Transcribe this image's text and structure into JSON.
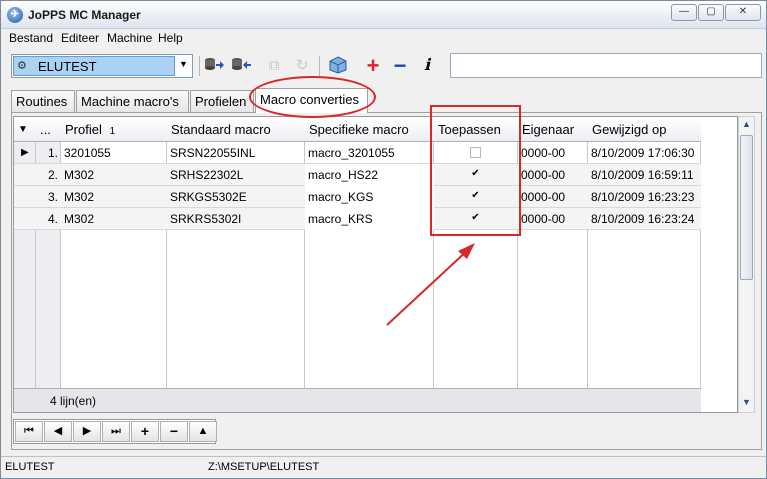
{
  "window": {
    "title": "JoPPS MC Manager",
    "controls": {
      "minimize": "—",
      "maximize": "▢",
      "close": "✕"
    }
  },
  "menu": [
    "Bestand",
    "Editeer",
    "Machine",
    "Help"
  ],
  "toolbar": {
    "machine_combo_value": "ELUTEST",
    "icons": [
      "db-export-icon",
      "db-import-icon",
      "copy-disabled-icon",
      "refresh-disabled-icon",
      "package-icon",
      "add-icon",
      "remove-icon",
      "info-icon"
    ]
  },
  "tabs": [
    {
      "label": "Routines",
      "active": false
    },
    {
      "label": "Machine macro's",
      "active": false
    },
    {
      "label": "Profielen",
      "active": false
    },
    {
      "label": "Macro converties",
      "active": true
    }
  ],
  "grid": {
    "columns": [
      "",
      "...",
      "Profiel",
      "Standaard macro",
      "Specifieke macro",
      "Toepassen",
      "Eigenaar",
      "Gewijzigd op"
    ],
    "sort_badge": "1",
    "rows": [
      {
        "num": "1.",
        "profiel": "3201055",
        "standaard": "SRSN22055INL",
        "specifiek": "macro_3201055",
        "toepassen": false,
        "eigenaar": "0000-00",
        "gewijzigd": "8/10/2009 17:06:30",
        "current": true
      },
      {
        "num": "2.",
        "profiel": "M302",
        "standaard": "SRHS22302L",
        "specifiek": "macro_HS22",
        "toepassen": true,
        "eigenaar": "0000-00",
        "gewijzigd": "8/10/2009 16:59:11",
        "current": false
      },
      {
        "num": "3.",
        "profiel": "M302",
        "standaard": "SRKGS5302E",
        "specifiek": "macro_KGS",
        "toepassen": true,
        "eigenaar": "0000-00",
        "gewijzigd": "8/10/2009 16:23:23",
        "current": false
      },
      {
        "num": "4.",
        "profiel": "M302",
        "standaard": "SRKRS5302I",
        "specifiek": "macro_KRS",
        "toepassen": true,
        "eigenaar": "0000-00",
        "gewijzigd": "8/10/2009 16:23:24",
        "current": false
      }
    ],
    "footer": "4 lijn(en)",
    "check_mark": "✔",
    "current_marker": "▶",
    "sort_indicator": "▼"
  },
  "navigator": [
    "⏮",
    "◀",
    "▶",
    "⏭",
    "+",
    "−",
    "▲"
  ],
  "status": {
    "machine": "ELUTEST",
    "path": "Z:\\MSETUP\\ELUTEST"
  },
  "colors": {
    "annotation": "#d8262b",
    "combo_selection": "#aad2f4",
    "add_icon": "#d8262b",
    "remove_icon": "#2246a8"
  }
}
